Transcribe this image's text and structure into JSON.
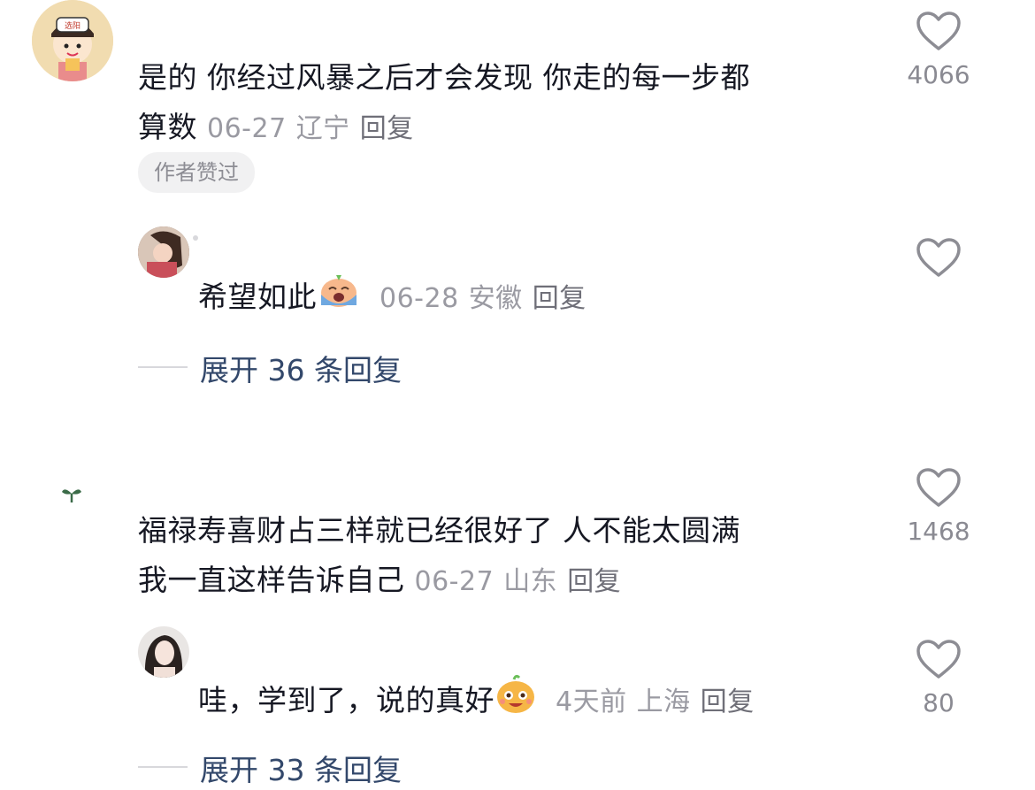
{
  "comments": [
    {
      "text_line1": "是的 你经过风暴之后才会发现 你走的每一步都",
      "text_line2": "算数",
      "date": "06-27",
      "location": "辽宁",
      "reply_label": "回复",
      "badge": "作者赞过",
      "likes": "4066",
      "avatar_text": "选阳",
      "replies": [
        {
          "text": "希望如此",
          "emoji": "crying-emoji",
          "date": "06-28",
          "location": "安徽",
          "reply_label": "回复",
          "likes": ""
        }
      ],
      "expand": {
        "prefix": "展开",
        "count": "36",
        "suffix": "条回复"
      }
    },
    {
      "text_line1": "福禄寿喜财占三样就已经很好了 人不能太圆满",
      "text_line2": "我一直这样告诉自己",
      "date": "06-27",
      "location": "山东",
      "reply_label": "回复",
      "likes": "1468",
      "replies": [
        {
          "text": "哇，学到了，说的真好",
          "emoji": "delighted-emoji",
          "date": "4天前",
          "location": "上海",
          "reply_label": "回复",
          "likes": "80"
        }
      ],
      "expand": {
        "prefix": "展开",
        "count": "33",
        "suffix": "条回复"
      }
    }
  ],
  "icons": {
    "like": "heart-outline-icon",
    "sprout": "sprout-icon"
  },
  "colors": {
    "text": "#161823",
    "meta": "#9a9aa2",
    "expand": "#33486b",
    "badge_bg": "#f1f1f2"
  }
}
